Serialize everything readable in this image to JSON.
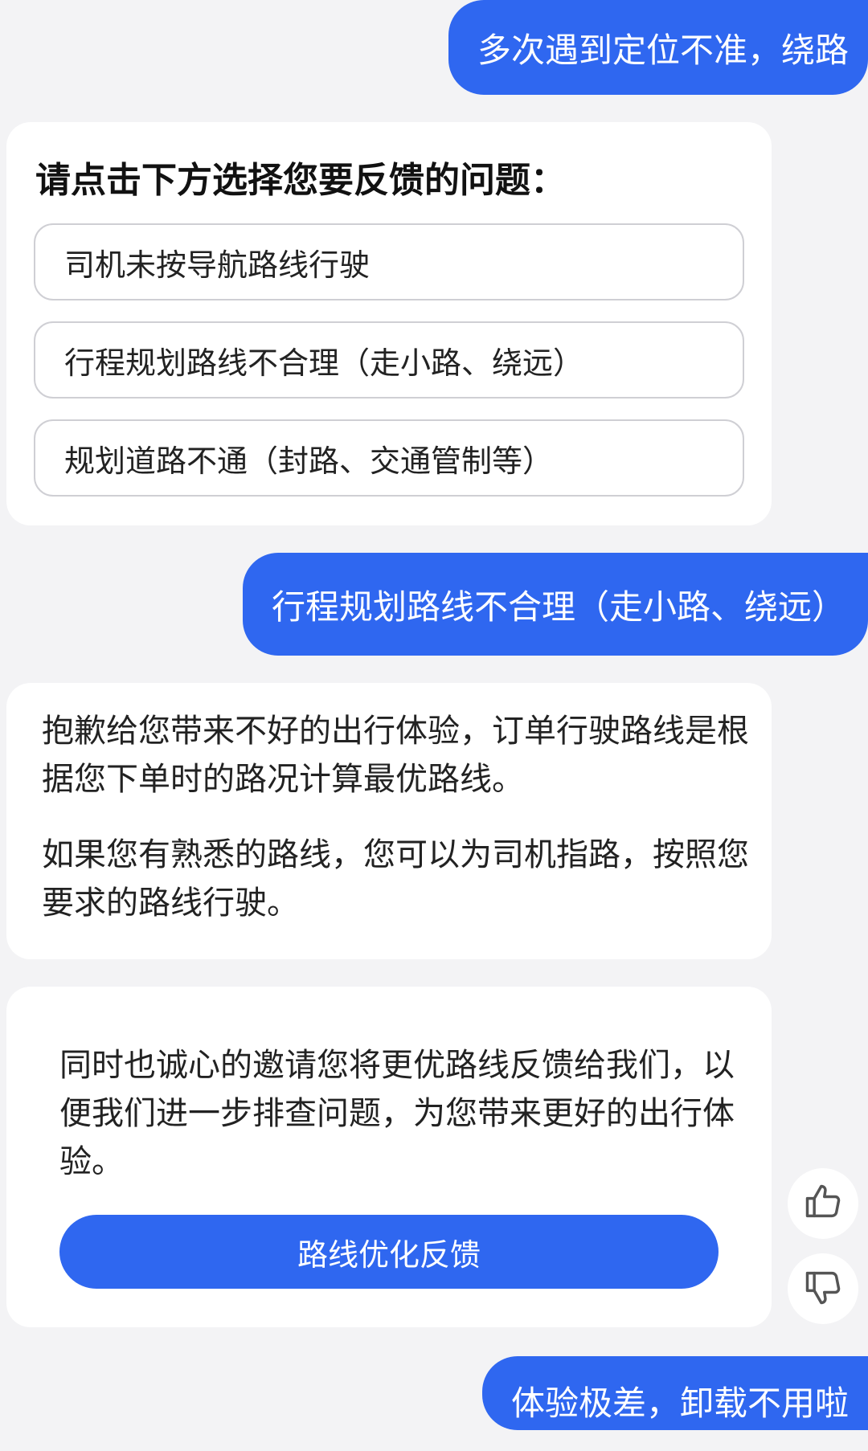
{
  "messages": {
    "user1": "多次遇到定位不准，绕路",
    "prompt": {
      "title": "请点击下方选择您要反馈的问题：",
      "options": [
        "司机未按导航路线行驶",
        "行程规划路线不合理（走小路、绕远）",
        "规划道路不通（封路、交通管制等）"
      ]
    },
    "user2": "行程规划路线不合理（走小路、绕远）",
    "reply1": {
      "para1": "抱歉给您带来不好的出行体验，订单行驶路线是根据您下单时的路况计算最优路线。",
      "para2": "如果您有熟悉的路线，您可以为司机指路，按照您要求的路线行驶。"
    },
    "reply2": {
      "text": "同时也诚心的邀请您将更优路线反馈给我们，以便我们进一步排查问题，为您带来更好的出行体验。",
      "button": "路线优化反馈"
    },
    "user3": "体验极差，卸载不用啦"
  },
  "icons": {
    "like": "thumbs-up-icon",
    "dislike": "thumbs-down-icon"
  },
  "colors": {
    "accent": "#2f67f0",
    "background": "#f3f3f5",
    "card": "#ffffff"
  }
}
